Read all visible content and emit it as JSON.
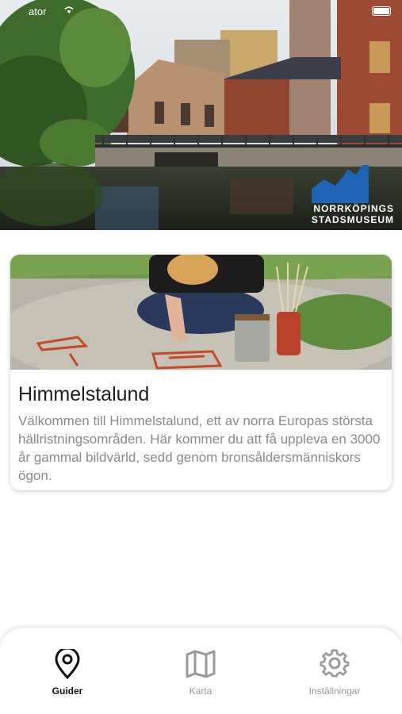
{
  "status_bar": {
    "carrier": "ator"
  },
  "header": {
    "logo_line1": "NORRKÖPINGS",
    "logo_line2": "STADSMUSEUM"
  },
  "card": {
    "title": "Himmelstalund",
    "description": "Välkommen till Himmelstalund, ett av norra Europas största hällristningsområden. Här kommer du att få uppleva en 3000 år gammal bildvärld, sedd genom bronsåldersmänniskors ögon."
  },
  "tabs": [
    {
      "label": "Guider",
      "icon": "map-pin-icon",
      "active": true
    },
    {
      "label": "Karta",
      "icon": "map-icon",
      "active": false
    },
    {
      "label": "Inställningar",
      "icon": "gear-icon",
      "active": false
    }
  ],
  "colors": {
    "active_tab": "#111111",
    "inactive_tab": "#9a9a9a",
    "logo_blue": "#1e63b4"
  }
}
